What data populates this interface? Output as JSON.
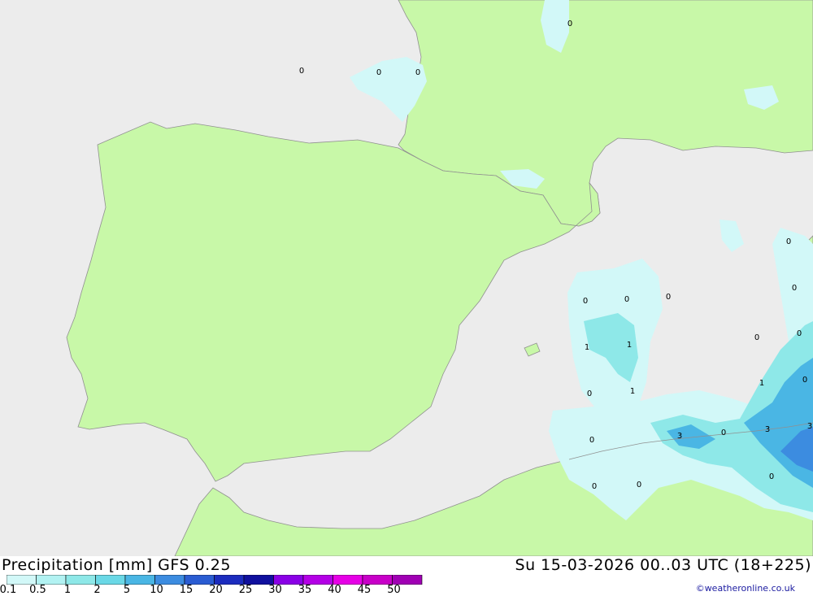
{
  "header": {
    "title": "Precipitation [mm] GFS 0.25",
    "datetime": "Su 15-03-2026 00..03 UTC (18+225)",
    "credit": "©weatheronline.co.uk"
  },
  "legend": {
    "labels": [
      "0.1",
      "0.5",
      "1",
      "2",
      "5",
      "10",
      "15",
      "20",
      "25",
      "30",
      "35",
      "40",
      "45",
      "50"
    ],
    "colors": [
      "#d2f8f8",
      "#b2f2f2",
      "#8ee8e8",
      "#6ad8e6",
      "#4ab6e4",
      "#3c8ce0",
      "#2a5cd2",
      "#1c2cbe",
      "#10109e",
      "#8a00e6",
      "#b400e6",
      "#e600e6",
      "#c800c8",
      "#a000b4"
    ]
  },
  "colors": {
    "sea": "#ececec",
    "land": "#c8f8a8",
    "precip_light": "#d2f8f8",
    "precip_mid": "#8ee8e8",
    "precip_heavy": "#4ab6e4",
    "border": "#909090"
  },
  "map": {
    "contour_labels": [
      "0",
      "0",
      "0",
      "0",
      "0",
      "0",
      "0",
      "0",
      "1",
      "1",
      "0",
      "1",
      "0",
      "3",
      "0",
      "0",
      "0",
      "0",
      "0",
      "1",
      "0",
      "3",
      "3",
      "0",
      "0"
    ]
  }
}
